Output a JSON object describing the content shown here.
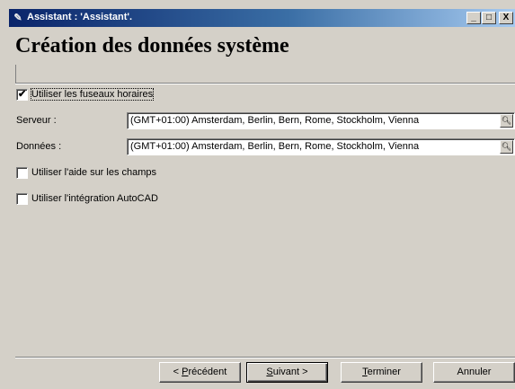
{
  "window": {
    "title": "Assistant : 'Assistant'.",
    "icon": "wizard-icon",
    "controls": {
      "minimize": "_",
      "maximize": "□",
      "close": "X"
    }
  },
  "header": {
    "title": "Création des données système"
  },
  "options": {
    "use_timezones": {
      "label": "Utiliser les fuseaux horaires",
      "checked": true
    },
    "use_field_help": {
      "label": "Utiliser l'aide sur les champs",
      "checked": false
    },
    "use_autocad": {
      "label": "Utiliser l'intégration AutoCAD",
      "checked": false
    }
  },
  "fields": {
    "server": {
      "label": "Serveur :",
      "value": "(GMT+01:00) Amsterdam, Berlin, Bern, Rome, Stockholm, Vienna",
      "icon": "search-icon"
    },
    "data": {
      "label": "Données :",
      "value": "(GMT+01:00) Amsterdam, Berlin, Bern, Rome, Stockholm, Vienna",
      "icon": "search-icon"
    }
  },
  "buttons": {
    "previous": {
      "prefix": "< ",
      "mnemonic": "P",
      "rest": "récédent"
    },
    "next": {
      "mnemonic": "S",
      "rest": "uivant",
      "suffix": " >"
    },
    "finish": {
      "mnemonic": "T",
      "rest": "erminer"
    },
    "cancel": {
      "label": "Annuler"
    }
  }
}
